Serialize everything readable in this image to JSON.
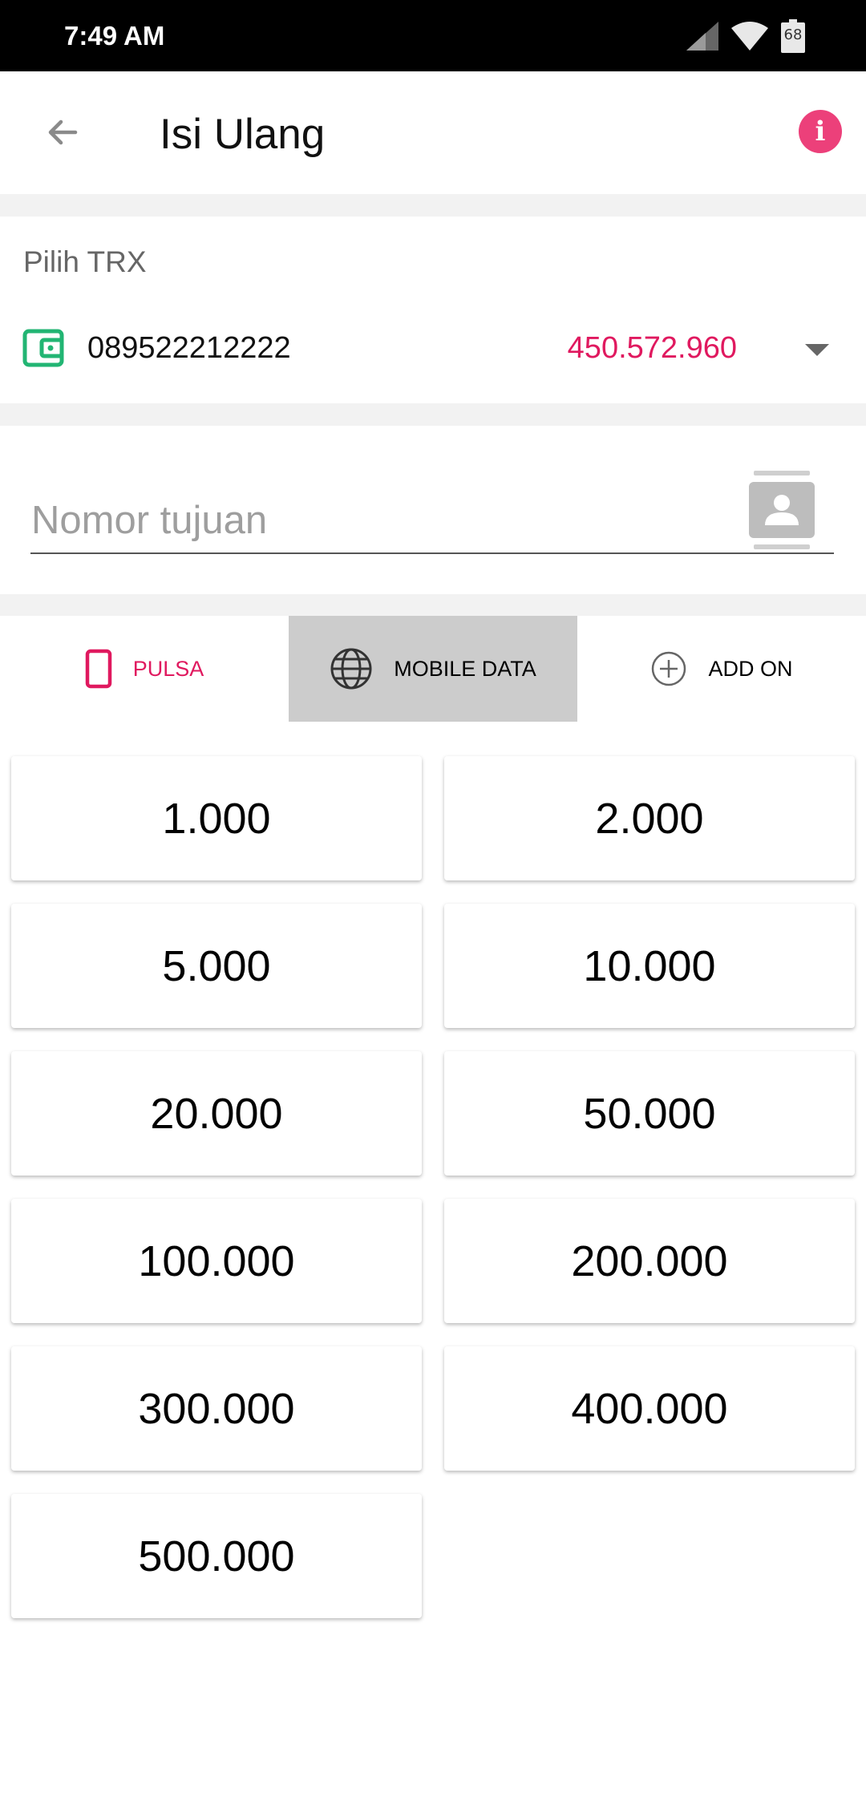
{
  "status_bar": {
    "time": "7:49 AM",
    "battery_level": "68"
  },
  "app_bar": {
    "title": "Isi Ulang"
  },
  "trx": {
    "label": "Pilih TRX",
    "number": "089522212222",
    "balance": "450.572.960"
  },
  "destination": {
    "placeholder": "Nomor tujuan",
    "value": ""
  },
  "tabs": [
    {
      "label": "PULSA",
      "icon": "phone-icon",
      "state": "active",
      "color": "#e0195f"
    },
    {
      "label": "MOBILE DATA",
      "icon": "globe-icon",
      "state": "pressed"
    },
    {
      "label": "ADD ON",
      "icon": "add-circle-icon",
      "state": "normal"
    }
  ],
  "nominals": [
    "1.000",
    "2.000",
    "5.000",
    "10.000",
    "20.000",
    "50.000",
    "100.000",
    "200.000",
    "300.000",
    "400.000",
    "500.000"
  ],
  "colors": {
    "accent": "#e0195f",
    "info": "#ec407a",
    "wallet": "#22b573",
    "pressed_tab": "#cccccc"
  }
}
